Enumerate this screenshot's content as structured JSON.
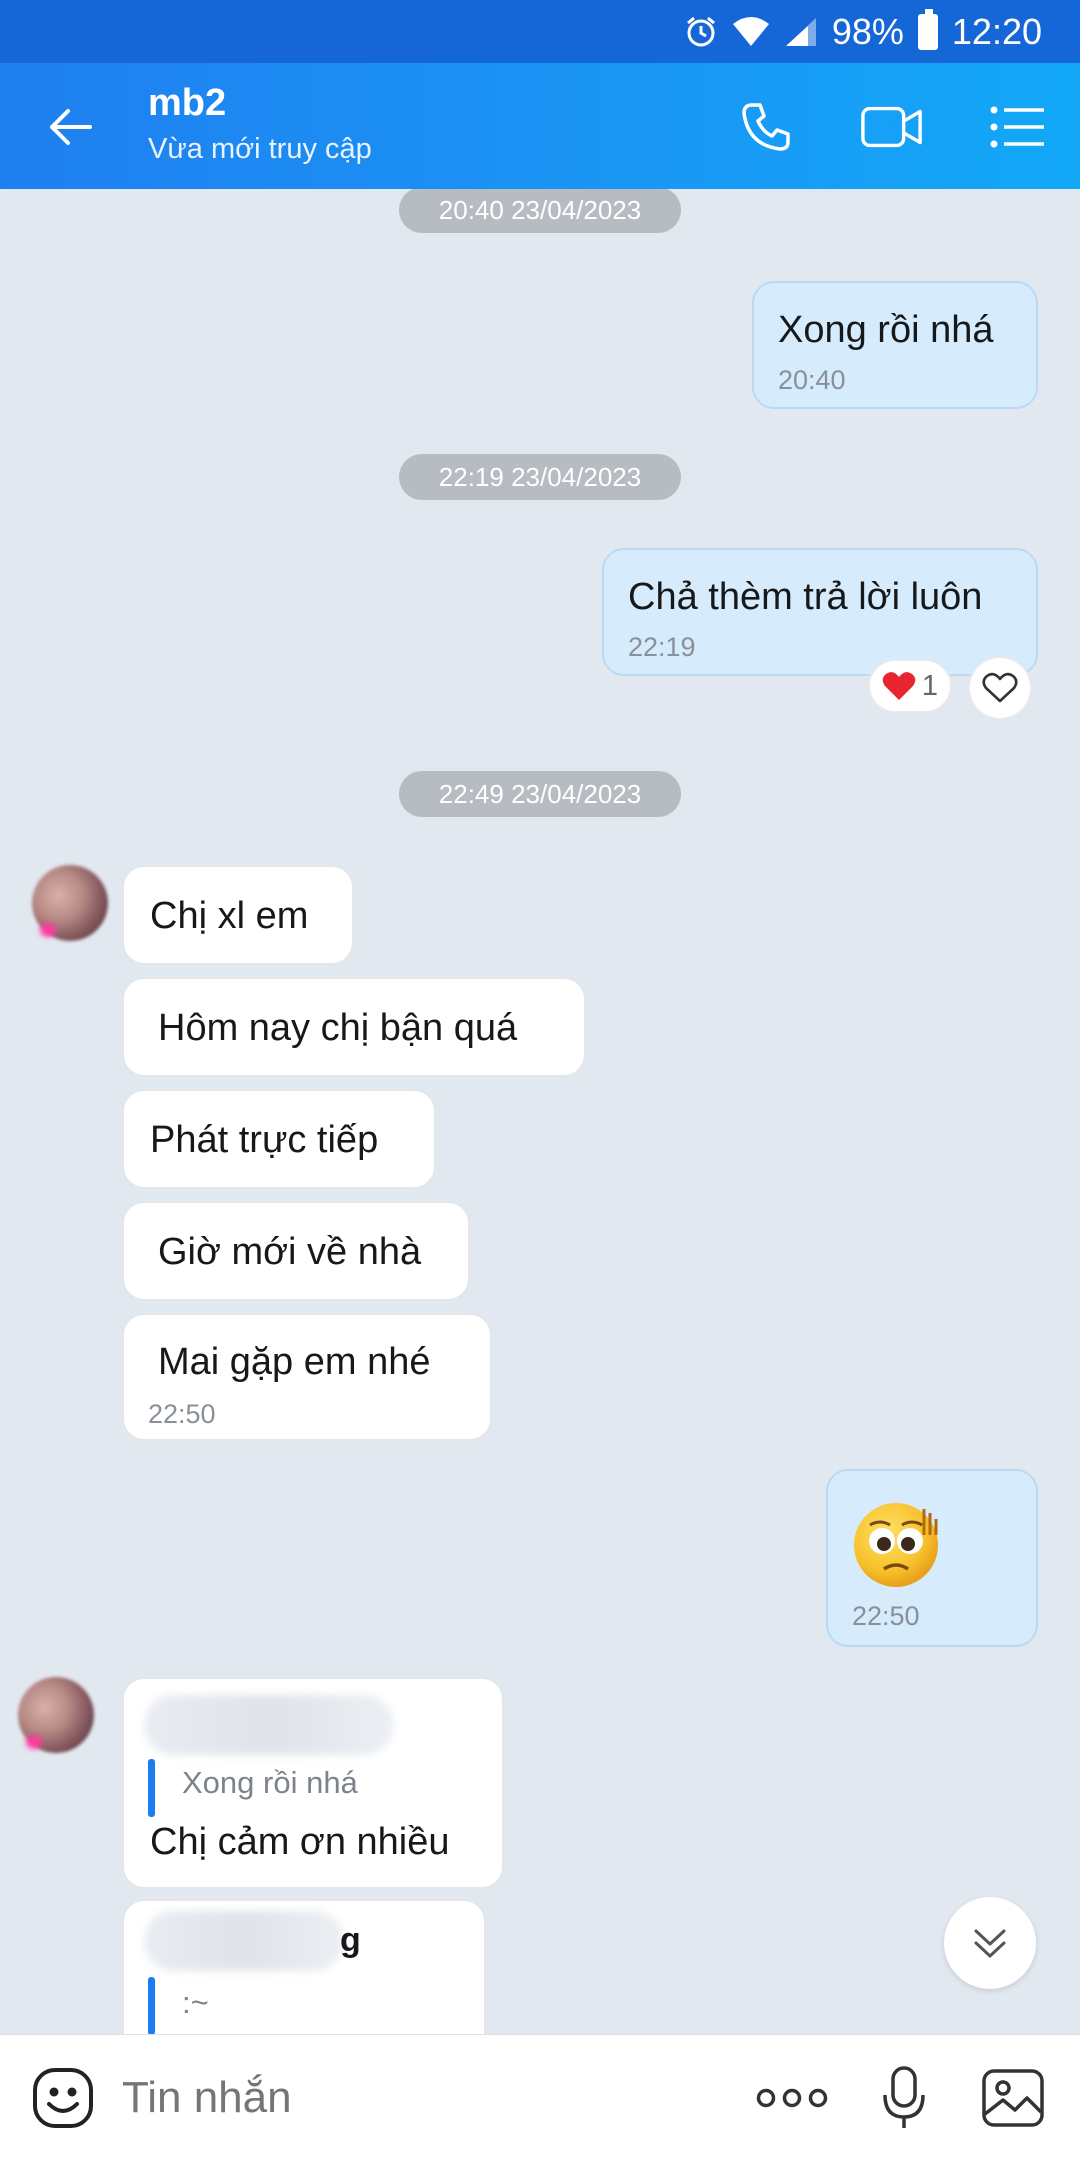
{
  "status_bar": {
    "battery": "98%",
    "time": "12:20",
    "icons": [
      "alarm-icon",
      "wifi-icon",
      "signal-icon",
      "battery-icon"
    ]
  },
  "header": {
    "contact_name": "mb2",
    "contact_status": "Vừa mới truy cập",
    "icons": [
      "back-arrow-icon",
      "phone-icon",
      "video-icon",
      "menu-icon"
    ]
  },
  "chat": {
    "timestamps": [
      "20:40 23/04/2023",
      "22:19 23/04/2023",
      "22:49 23/04/2023"
    ],
    "messages": [
      {
        "direction": "out",
        "text": "Xong rồi nhá",
        "time": "20:40"
      },
      {
        "direction": "out",
        "text": "Chả thèm trả lời luôn",
        "time": "22:19"
      },
      {
        "direction": "in",
        "text": "Chị xl em"
      },
      {
        "direction": "in",
        "text": "Hôm nay chị bận quá"
      },
      {
        "direction": "in",
        "text": "Phát trực tiếp"
      },
      {
        "direction": "in",
        "text": "Giờ mới về nhà"
      },
      {
        "direction": "in",
        "text": "Mai gặp em nhé",
        "time": "22:50"
      },
      {
        "direction": "out",
        "sticker": "worried-face-sticker",
        "time": "22:50"
      },
      {
        "direction": "in",
        "quote": "Xong rồi nhá",
        "text": "Chị cảm ơn nhiều"
      },
      {
        "direction": "in",
        "quote_name_tail": "g",
        "quote": ":~"
      }
    ],
    "reaction": {
      "emoji": "❤️",
      "count": "1"
    }
  },
  "composer": {
    "placeholder": "Tin nhắn",
    "icons": [
      "emoji-icon",
      "more-icon",
      "microphone-icon",
      "image-icon"
    ]
  },
  "colors": {
    "header_blue": "#1a8cf2",
    "status_blue": "#1567d8",
    "outgoing_bubble": "#d6ecfd",
    "chat_bg": "#e2e8f0"
  }
}
